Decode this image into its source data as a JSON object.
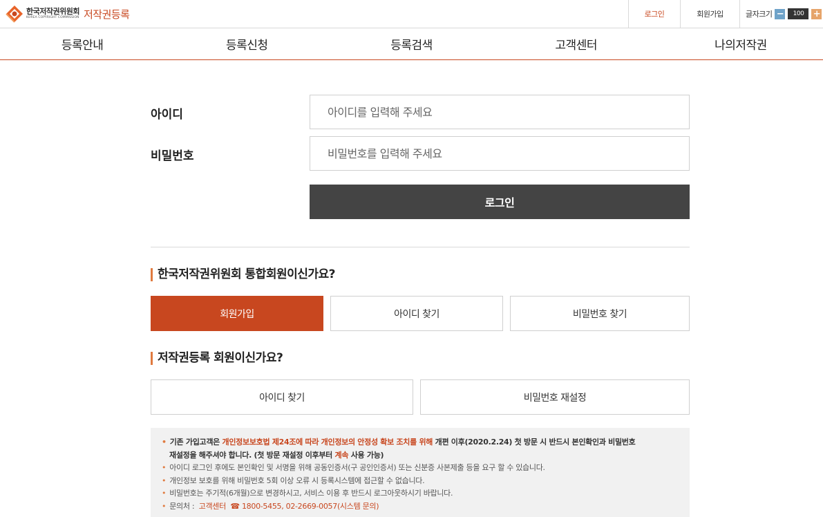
{
  "header": {
    "org_name_ko": "한국저작권위원회",
    "org_name_en": "KOREA COPYRIGHT COMMISSION",
    "service_name": "저작권등록",
    "util": {
      "login": "로그인",
      "join": "회원가입",
      "font_size_label": "글자크기",
      "font_size_value": "100"
    }
  },
  "nav": [
    "등록안내",
    "등록신청",
    "등록검색",
    "고객센터",
    "나의저작권"
  ],
  "login_form": {
    "id_label": "아이디",
    "id_placeholder": "아이디를 입력해 주세요",
    "pw_label": "비밀번호",
    "pw_placeholder": "비밀번호를 입력해 주세요",
    "submit": "로그인"
  },
  "integrated_member": {
    "title": "한국저작권위원회 통합회원이신가요?",
    "join": "회원가입",
    "find_id": "아이디 찾기",
    "find_pw": "비밀번호 찾기"
  },
  "registration_member": {
    "title": "저작권등록 회원이신가요?",
    "find_id": "아이디 찾기",
    "reset_pw": "비밀번호 재설정"
  },
  "notice": {
    "line1_a": "기존 가입고객은 ",
    "line1_b": "개인정보보호법 제24조에 따라 개인정보의 안정성 확보 조치를 위해",
    "line1_c": " 개편 이후(2020.2.24) 첫 방문 시 반드시 본인확인과 비밀번호",
    "line1_d": "재설정을 해주셔야 합니다. (첫 방문 재설정 이후부터 ",
    "line1_e": "계속",
    "line1_f": " 사용 가능)",
    "line2": "아이디 로그인 후에도 본인확인 및 서명을 위해 공동인증서(구 공인인증서) 또는 신분증 사본제출 등을 요구 할 수 있습니다.",
    "line3": "개인정보 보호를 위해 비밀번호 5회 이상 오류 시 등록시스템에 접근할 수 없습니다.",
    "line4": "비밀번호는 주기적(6개월)으로 변경하시고, 서비스 이용 후 반드시 로그아웃하시기 바랍니다.",
    "contact_label": "문의처 :",
    "contact_link": "고객센터",
    "contact_phone": "1800-5455, 02-2669-0057(시스템 문의)"
  },
  "colors": {
    "brand": "#c8471f",
    "accent": "#e07a3f",
    "dark_button": "#444444"
  }
}
